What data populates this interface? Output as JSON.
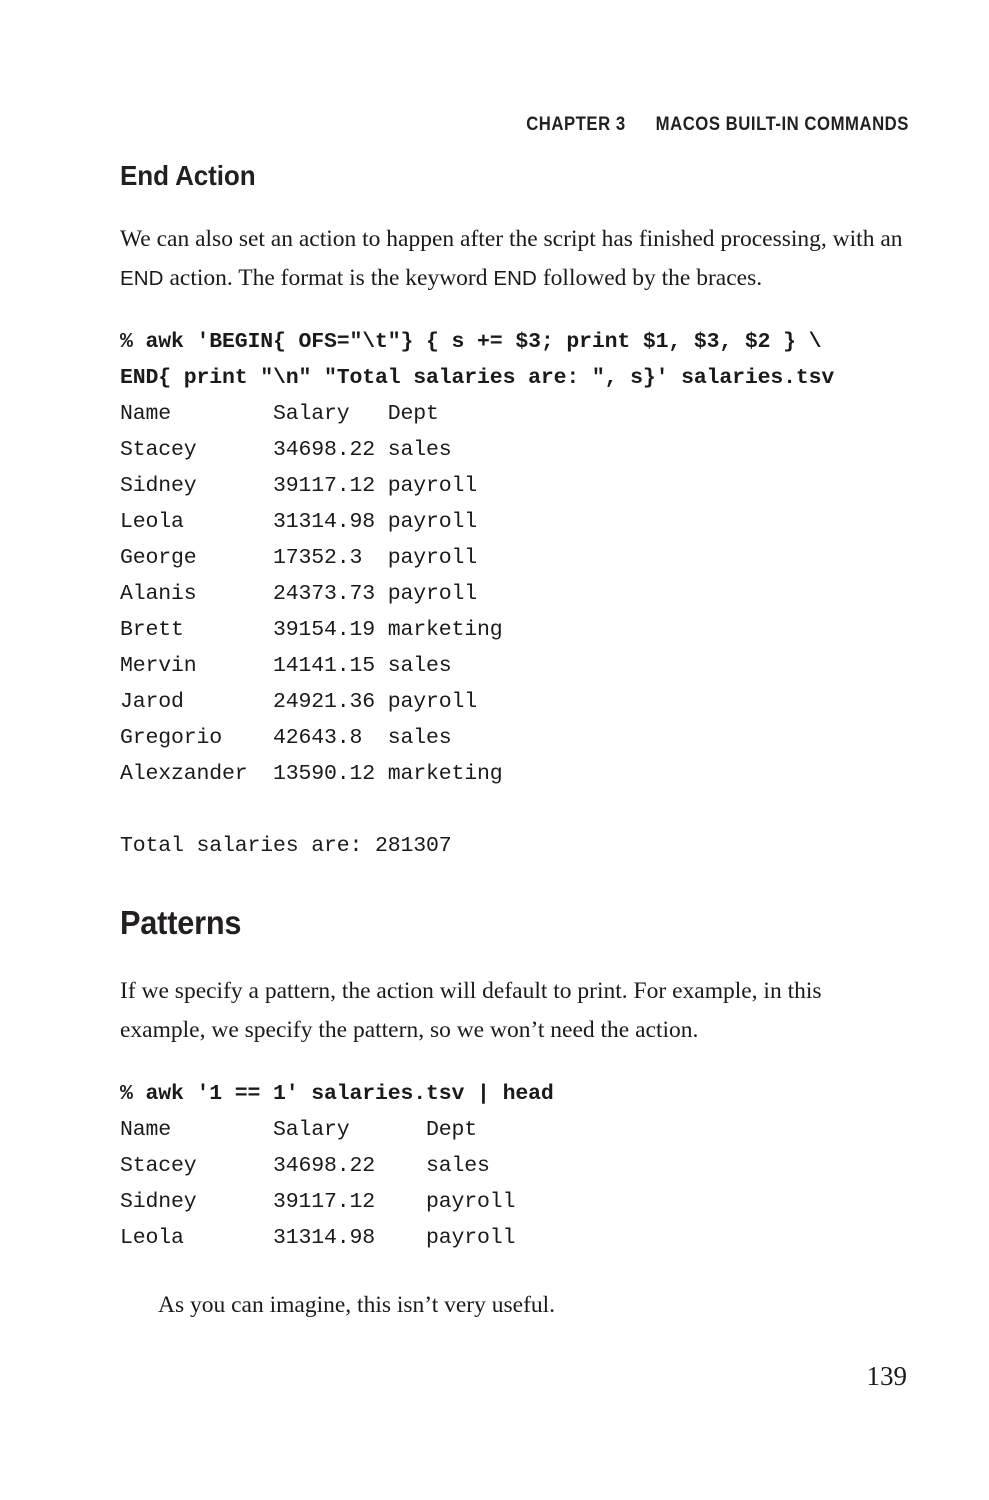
{
  "running_head": {
    "chapter": "CHAPTER 3",
    "title": "MACOS BUILT-IN COMMANDS"
  },
  "sections": {
    "end_action": {
      "heading": "End Action",
      "paragraph_1_pre": "We can also set an action to happen after the script has finished processing, with an ",
      "paragraph_1_kw1": "END",
      "paragraph_1_mid": " action. The format is the keyword ",
      "paragraph_1_kw2": "END",
      "paragraph_1_post": " followed by the braces."
    },
    "patterns": {
      "heading": "Patterns",
      "paragraph_1": "If we specify a pattern, the action will default to print. For example, in this example, we specify the pattern, so we won’t need the action.",
      "paragraph_2": "As you can imagine, this isn’t very useful."
    }
  },
  "code_blocks": {
    "awk_end_command": "% awk 'BEGIN{ OFS=\"\\t\"} { s += $3; print $1, $3, $2 } \\\nEND{ print \"\\n\" \"Total salaries are: \", s}' salaries.tsv",
    "awk_end_output": "Name        Salary   Dept\nStacey      34698.22 sales\nSidney      39117.12 payroll\nLeola       31314.98 payroll\nGeorge      17352.3  payroll\nAlanis      24373.73 payroll\nBrett       39154.19 marketing\nMervin      14141.15 sales\nJarod       24921.36 payroll\nGregorio    42643.8  sales\nAlexzander  13590.12 marketing\n\nTotal salaries are: 281307",
    "awk_pattern_command": "% awk '1 == 1' salaries.tsv | head",
    "awk_pattern_output": "Name        Salary      Dept\nStacey      34698.22    sales\nSidney      39117.12    payroll\nLeola       31314.98    payroll"
  },
  "tables": {
    "salaries_full": {
      "columns": [
        "Name",
        "Salary",
        "Dept"
      ],
      "rows": [
        [
          "Stacey",
          "34698.22",
          "sales"
        ],
        [
          "Sidney",
          "39117.12",
          "payroll"
        ],
        [
          "Leola",
          "31314.98",
          "payroll"
        ],
        [
          "George",
          "17352.3",
          "payroll"
        ],
        [
          "Alanis",
          "24373.73",
          "payroll"
        ],
        [
          "Brett",
          "39154.19",
          "marketing"
        ],
        [
          "Mervin",
          "14141.15",
          "sales"
        ],
        [
          "Jarod",
          "24921.36",
          "payroll"
        ],
        [
          "Gregorio",
          "42643.8",
          "sales"
        ],
        [
          "Alexzander",
          "13590.12",
          "marketing"
        ]
      ],
      "total_label": "Total salaries are:",
      "total_value": "281307"
    },
    "salaries_head": {
      "columns": [
        "Name",
        "Salary",
        "Dept"
      ],
      "rows": [
        [
          "Stacey",
          "34698.22",
          "sales"
        ],
        [
          "Sidney",
          "39117.12",
          "payroll"
        ],
        [
          "Leola",
          "31314.98",
          "payroll"
        ]
      ]
    }
  },
  "folio": {
    "page_number": "139"
  },
  "colors": {
    "page_background": "#ffffff",
    "body_text": "#1a1a1a",
    "heading_text": "#231f20"
  }
}
